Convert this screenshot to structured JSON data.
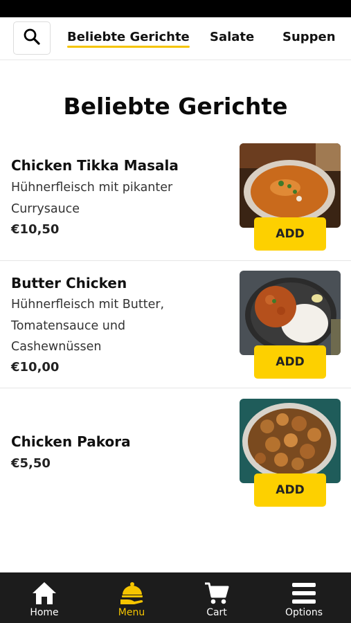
{
  "nav": {
    "search_icon": "search-icon",
    "tabs": [
      {
        "label": "Beliebte Gerichte",
        "active": true
      },
      {
        "label": "Salate",
        "active": false
      },
      {
        "label": "Suppen",
        "active": false
      }
    ]
  },
  "page_title": "Beliebte Gerichte",
  "dishes": [
    {
      "name": "Chicken Tikka Masala",
      "description": "Hühnerfleisch mit pikanter Currysauce",
      "price": "€10,50",
      "add_label": "ADD"
    },
    {
      "name": "Butter Chicken",
      "description": "Hühnerfleisch mit Butter, Tomatensauce und Cashewnüssen",
      "price": "€10,00",
      "add_label": "ADD"
    },
    {
      "name": "Chicken Pakora",
      "description": "",
      "price": "€5,50",
      "add_label": "ADD"
    }
  ],
  "bottom_nav": [
    {
      "label": "Home",
      "icon": "home-icon",
      "active": false
    },
    {
      "label": "Menu",
      "icon": "menu-icon",
      "active": true
    },
    {
      "label": "Cart",
      "icon": "cart-icon",
      "active": false
    },
    {
      "label": "Options",
      "icon": "options-icon",
      "active": false
    }
  ],
  "colors": {
    "accent": "#fdd000",
    "nav_background": "#1c1c1c",
    "active_nav_label": "#f5c400"
  }
}
